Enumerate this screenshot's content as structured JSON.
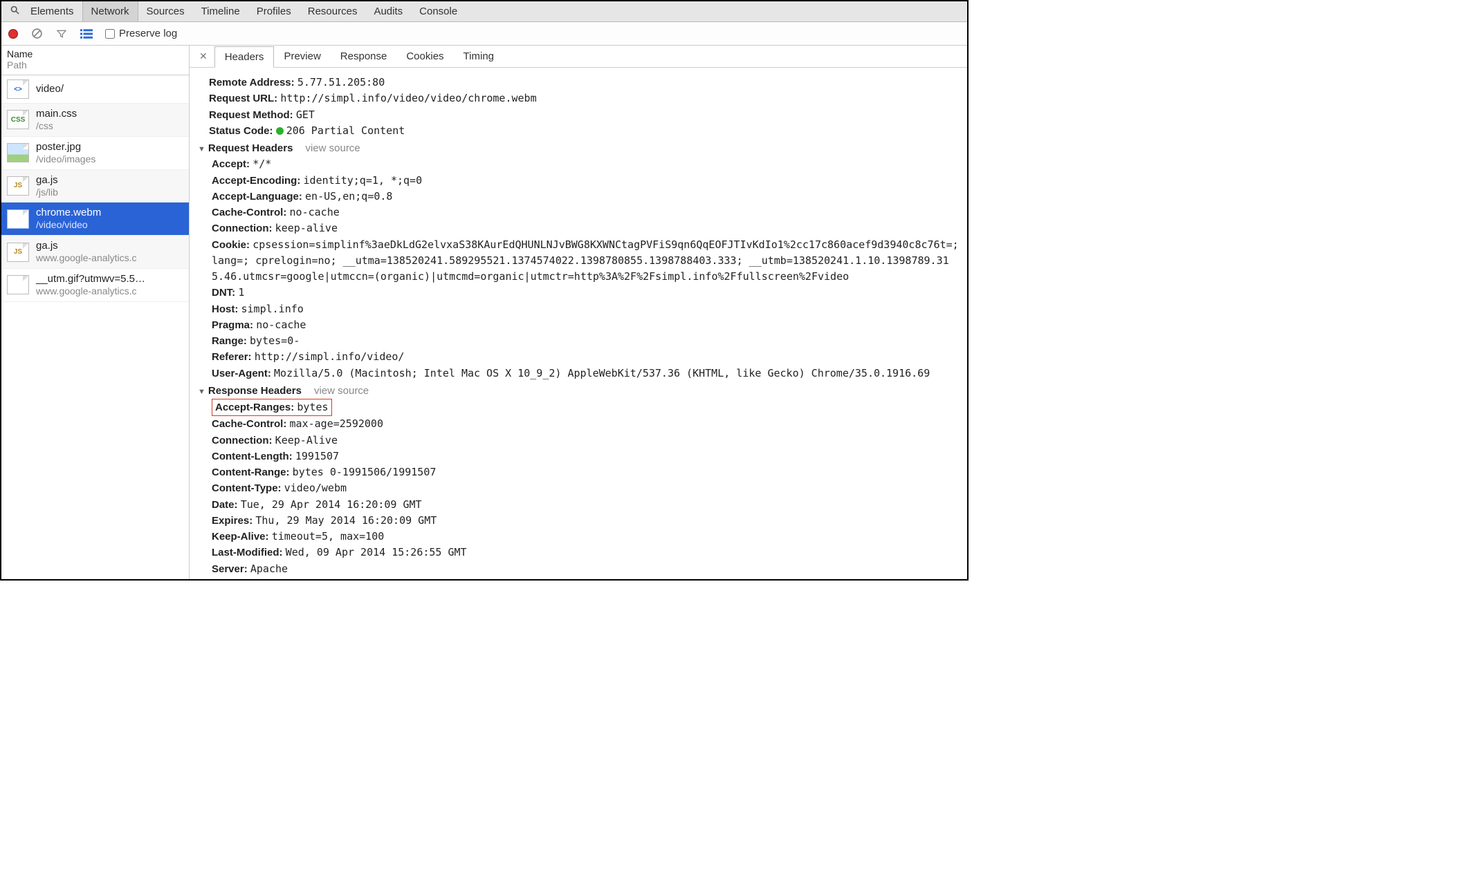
{
  "topTabs": {
    "items": [
      "Elements",
      "Network",
      "Sources",
      "Timeline",
      "Profiles",
      "Resources",
      "Audits",
      "Console"
    ],
    "active": "Network"
  },
  "toolbar": {
    "preserveLabel": "Preserve log"
  },
  "sidebar": {
    "header": {
      "name": "Name",
      "path": "Path"
    },
    "items": [
      {
        "icon": "html",
        "label": "<>",
        "name": "video/",
        "path": ""
      },
      {
        "icon": "css",
        "label": "CSS",
        "name": "main.css",
        "path": "/css"
      },
      {
        "icon": "img",
        "label": "",
        "name": "poster.jpg",
        "path": "/video/images"
      },
      {
        "icon": "js",
        "label": "JS",
        "name": "ga.js",
        "path": "/js/lib"
      },
      {
        "icon": "media",
        "label": "",
        "name": "chrome.webm",
        "path": "/video/video",
        "selected": true
      },
      {
        "icon": "js",
        "label": "JS",
        "name": "ga.js",
        "path": "www.google-analytics.c"
      },
      {
        "icon": "media",
        "label": "",
        "name": "__utm.gif?utmwv=5.5…",
        "path": "www.google-analytics.c"
      }
    ]
  },
  "detailTabs": {
    "items": [
      "Headers",
      "Preview",
      "Response",
      "Cookies",
      "Timing"
    ],
    "active": "Headers"
  },
  "general": {
    "remoteAddressLabel": "Remote Address:",
    "remoteAddress": "5.77.51.205:80",
    "requestUrlLabel": "Request URL:",
    "requestUrl": "http://simpl.info/video/video/chrome.webm",
    "requestMethodLabel": "Request Method:",
    "requestMethod": "GET",
    "statusCodeLabel": "Status Code:",
    "statusCode": "206 Partial Content"
  },
  "requestHeaders": {
    "title": "Request Headers",
    "viewSource": "view source",
    "items": [
      {
        "k": "Accept:",
        "v": "*/*"
      },
      {
        "k": "Accept-Encoding:",
        "v": "identity;q=1, *;q=0"
      },
      {
        "k": "Accept-Language:",
        "v": "en-US,en;q=0.8"
      },
      {
        "k": "Cache-Control:",
        "v": "no-cache"
      },
      {
        "k": "Connection:",
        "v": "keep-alive"
      },
      {
        "k": "Cookie:",
        "v": "cpsession=simplinf%3aeDkLdG2elvxaS38KAurEdQHUNLNJvBWG8KXWNCtagPVFiS9qn6QqEOFJTIvKdIo1%2cc17c860acef9d3940c8c76t=; lang=; cprelogin=no; __utma=138520241.589295521.1374574022.1398780855.1398788403.333; __utmb=138520241.1.10.1398789.315.46.utmcsr=google|utmccn=(organic)|utmcmd=organic|utmctr=http%3A%2F%2Fsimpl.info%2Ffullscreen%2Fvideo"
      },
      {
        "k": "DNT:",
        "v": "1"
      },
      {
        "k": "Host:",
        "v": "simpl.info"
      },
      {
        "k": "Pragma:",
        "v": "no-cache"
      },
      {
        "k": "Range:",
        "v": "bytes=0-"
      },
      {
        "k": "Referer:",
        "v": "http://simpl.info/video/"
      },
      {
        "k": "User-Agent:",
        "v": "Mozilla/5.0 (Macintosh; Intel Mac OS X 10_9_2) AppleWebKit/537.36 (KHTML, like Gecko) Chrome/35.0.1916.69"
      }
    ]
  },
  "responseHeaders": {
    "title": "Response Headers",
    "viewSource": "view source",
    "items": [
      {
        "k": "Accept-Ranges:",
        "v": "bytes",
        "hl": true
      },
      {
        "k": "Cache-Control:",
        "v": "max-age=2592000"
      },
      {
        "k": "Connection:",
        "v": "Keep-Alive"
      },
      {
        "k": "Content-Length:",
        "v": "1991507"
      },
      {
        "k": "Content-Range:",
        "v": "bytes 0-1991506/1991507"
      },
      {
        "k": "Content-Type:",
        "v": "video/webm"
      },
      {
        "k": "Date:",
        "v": "Tue, 29 Apr 2014 16:20:09 GMT"
      },
      {
        "k": "Expires:",
        "v": "Thu, 29 May 2014 16:20:09 GMT"
      },
      {
        "k": "Keep-Alive:",
        "v": "timeout=5, max=100"
      },
      {
        "k": "Last-Modified:",
        "v": "Wed, 09 Apr 2014 15:26:55 GMT"
      },
      {
        "k": "Server:",
        "v": "Apache"
      }
    ]
  }
}
